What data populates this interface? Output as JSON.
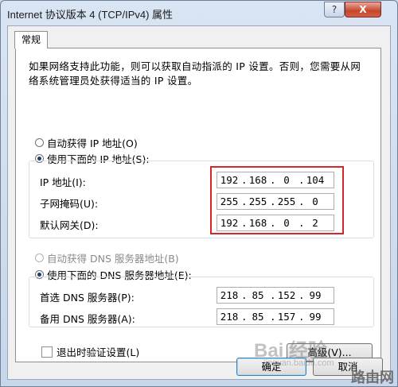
{
  "window": {
    "title": "Internet 协议版本 4 (TCP/IPv4) 属性",
    "help_label": "?",
    "close_label": "X"
  },
  "tabs": [
    {
      "label": "常规"
    }
  ],
  "description": "如果网络支持此功能，则可以获取自动指派的 IP 设置。否则，您需要从网络系统管理员处获得适当的 IP 设置。",
  "ip_section": {
    "auto_label": "自动获得 IP 地址(O)",
    "manual_label": "使用下面的 IP 地址(S):",
    "selected": "manual",
    "fields": [
      {
        "label": "IP 地址(I):",
        "octets": [
          "192",
          "168",
          "0",
          "104"
        ]
      },
      {
        "label": "子网掩码(U):",
        "octets": [
          "255",
          "255",
          "255",
          "0"
        ]
      },
      {
        "label": "默认网关(D):",
        "octets": [
          "192",
          "168",
          "0",
          "2"
        ]
      }
    ]
  },
  "dns_section": {
    "auto_label": "自动获得 DNS 服务器地址(B)",
    "manual_label": "使用下面的 DNS 服务器地址(E):",
    "selected": "manual",
    "fields": [
      {
        "label": "首选 DNS 服务器(P):",
        "octets": [
          "218",
          "85",
          "152",
          "99"
        ]
      },
      {
        "label": "备用 DNS 服务器(A):",
        "octets": [
          "218",
          "85",
          "157",
          "99"
        ]
      }
    ]
  },
  "validate_checkbox": {
    "label": "退出时验证设置(L)",
    "checked": false
  },
  "buttons": {
    "advanced": "高级(V)...",
    "ok": "确定",
    "cancel": "取消"
  },
  "watermarks": {
    "baidu": "Bai 经验",
    "url": "jingyan.baidu.com",
    "luyou": "路由网"
  },
  "colors": {
    "highlight": "#d6262a",
    "close_button": "#c7462c"
  }
}
